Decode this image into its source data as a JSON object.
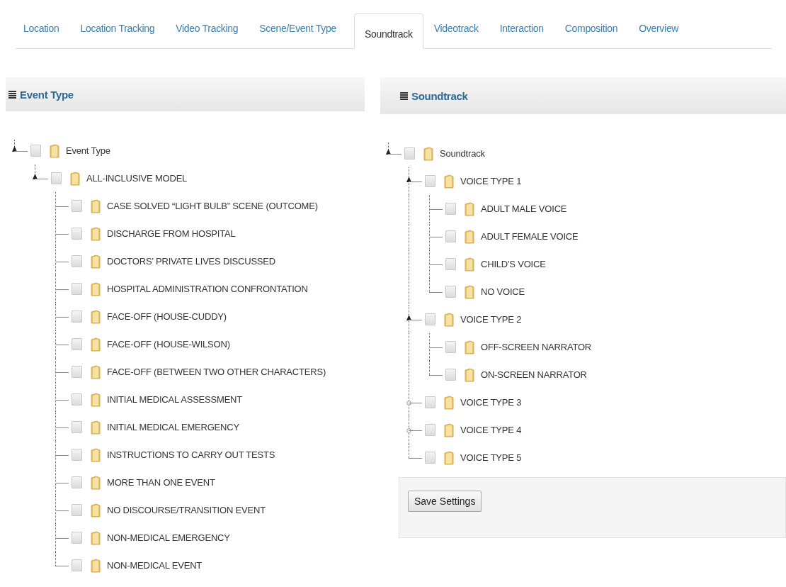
{
  "tabs": [
    {
      "label": "Location",
      "selected": false
    },
    {
      "label": "Location Tracking",
      "selected": false
    },
    {
      "label": "Video Tracking",
      "selected": false
    },
    {
      "label": "Scene/Event Type",
      "selected": false
    },
    {
      "label": "Soundtrack",
      "selected": true
    },
    {
      "label": "Videotrack",
      "selected": false
    },
    {
      "label": "Interaction",
      "selected": false
    },
    {
      "label": "Composition",
      "selected": false
    },
    {
      "label": "Overview",
      "selected": false
    }
  ],
  "panels": [
    {
      "title": "Event Type",
      "tree": [
        {
          "label": "Event Type",
          "checked": false,
          "expanded": true,
          "children": [
            {
              "label": "ALL-INCLUSIVE MODEL",
              "checked": false,
              "expanded": true,
              "children": [
                {
                  "label": "CASE SOLVED “LIGHT BULB” SCENE (OUTCOME)",
                  "checked": false
                },
                {
                  "label": "DISCHARGE FROM HOSPITAL",
                  "checked": false
                },
                {
                  "label": "DOCTORS’ PRIVATE LIVES DISCUSSED",
                  "checked": false
                },
                {
                  "label": "HOSPITAL ADMINISTRATION CONFRONTATION",
                  "checked": false
                },
                {
                  "label": "FACE-OFF (HOUSE-CUDDY)",
                  "checked": false
                },
                {
                  "label": "FACE-OFF (HOUSE-WILSON)",
                  "checked": false
                },
                {
                  "label": "FACE-OFF (BETWEEN TWO OTHER CHARACTERS)",
                  "checked": false
                },
                {
                  "label": "INITIAL MEDICAL ASSESSMENT",
                  "checked": false
                },
                {
                  "label": "INITIAL MEDICAL EMERGENCY",
                  "checked": false
                },
                {
                  "label": "INSTRUCTIONS TO CARRY OUT TESTS",
                  "checked": false
                },
                {
                  "label": "MORE THAN ONE EVENT",
                  "checked": false
                },
                {
                  "label": "NO DISCOURSE/TRANSITION EVENT",
                  "checked": false
                },
                {
                  "label": "NON-MEDICAL EMERGENCY",
                  "checked": false
                },
                {
                  "label": "NON-MEDICAL EVENT",
                  "checked": false
                }
              ]
            }
          ]
        }
      ]
    },
    {
      "title": "Soundtrack",
      "button": "Save Settings",
      "tree": [
        {
          "label": "Soundtrack",
          "checked": false,
          "expanded": true,
          "children": [
            {
              "label": "VOICE TYPE 1",
              "checked": false,
              "expanded": true,
              "children": [
                {
                  "label": "ADULT MALE VOICE",
                  "checked": false
                },
                {
                  "label": "ADULT FEMALE VOICE",
                  "checked": false
                },
                {
                  "label": "CHILD'S VOICE",
                  "checked": false
                },
                {
                  "label": "NO VOICE",
                  "checked": false
                }
              ]
            },
            {
              "label": "VOICE TYPE 2",
              "checked": false,
              "expanded": true,
              "children": [
                {
                  "label": "OFF-SCREEN NARRATOR",
                  "checked": false
                },
                {
                  "label": "ON-SCREEN NARRATOR",
                  "checked": false
                }
              ]
            },
            {
              "label": "VOICE TYPE 3",
              "checked": false,
              "expanded": false
            },
            {
              "label": "VOICE TYPE 4",
              "checked": false,
              "expanded": false
            },
            {
              "label": "VOICE TYPE 5",
              "checked": false
            }
          ]
        }
      ]
    }
  ]
}
